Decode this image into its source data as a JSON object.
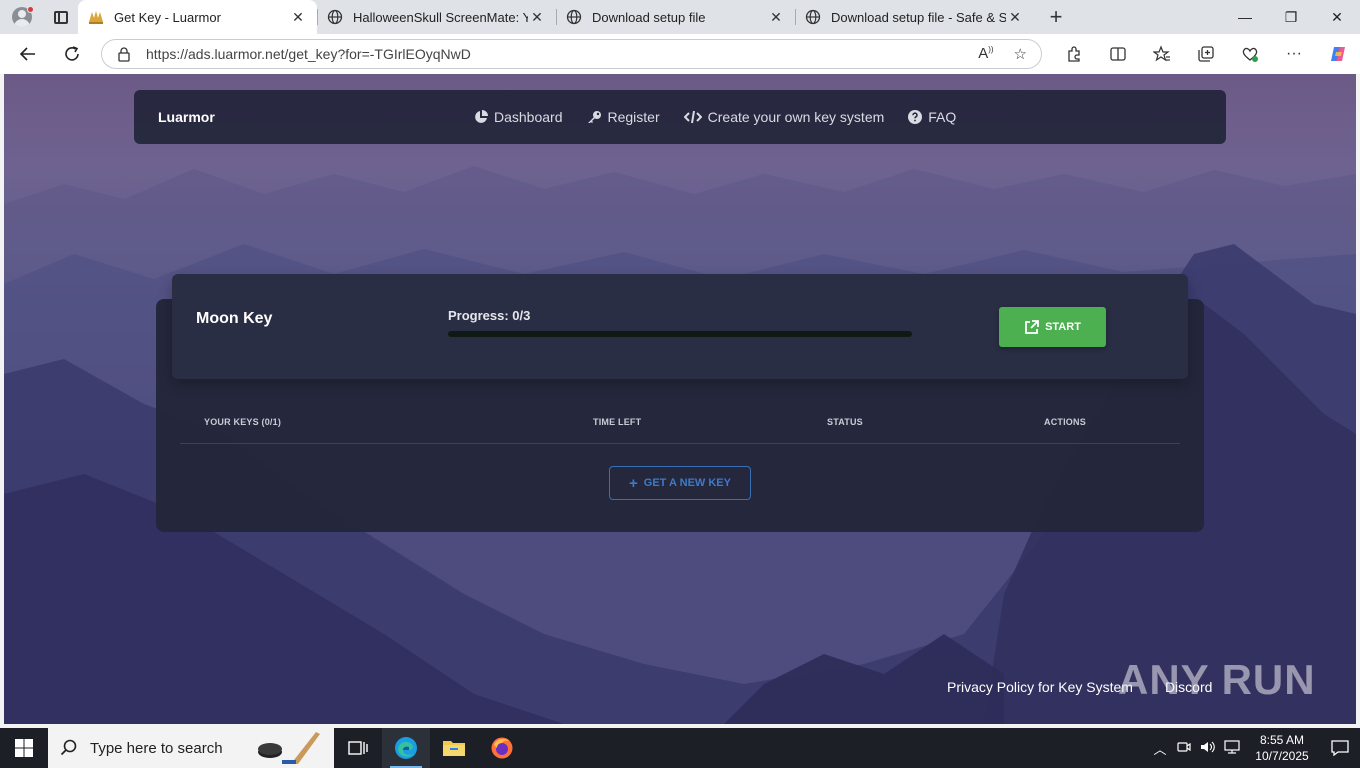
{
  "browser": {
    "tabs": [
      {
        "title": "Get Key - Luarmor",
        "active": true,
        "icon": "luarmor-icon"
      },
      {
        "title": "HalloweenSkull ScreenMate: Your",
        "active": false,
        "icon": "globe-icon"
      },
      {
        "title": "Download setup file",
        "active": false,
        "icon": "globe-icon"
      },
      {
        "title": "Download setup file - Safe & Secu",
        "active": false,
        "icon": "globe-icon"
      }
    ],
    "url": "https://ads.luarmor.net/get_key?for=-TGIrlEOyqNwD"
  },
  "page": {
    "brand": "Luarmor",
    "nav": [
      {
        "label": "Dashboard",
        "icon": "pie-chart-icon"
      },
      {
        "label": "Register",
        "icon": "key-icon"
      },
      {
        "label": "Create your own key system",
        "icon": "code-icon"
      },
      {
        "label": "FAQ",
        "icon": "question-circle-icon"
      }
    ],
    "key_card": {
      "name": "Moon Key",
      "progress_label": "Progress: 0/3",
      "progress_fraction": 0,
      "start_label": "START"
    },
    "table": {
      "headers": [
        "YOUR KEYS (0/1)",
        "TIME LEFT",
        "STATUS",
        "ACTIONS"
      ],
      "new_key_label": "GET A NEW KEY"
    },
    "footer": {
      "privacy": "Privacy Policy for Key System",
      "discord": "Discord"
    },
    "watermark": "ANY RUN"
  },
  "taskbar": {
    "search_placeholder": "Type here to search",
    "time": "8:55 AM",
    "date": "10/7/2025"
  },
  "colors": {
    "accent_green": "#4caf50",
    "accent_blue": "#3f79c7",
    "nav_bg": "#22263a"
  }
}
